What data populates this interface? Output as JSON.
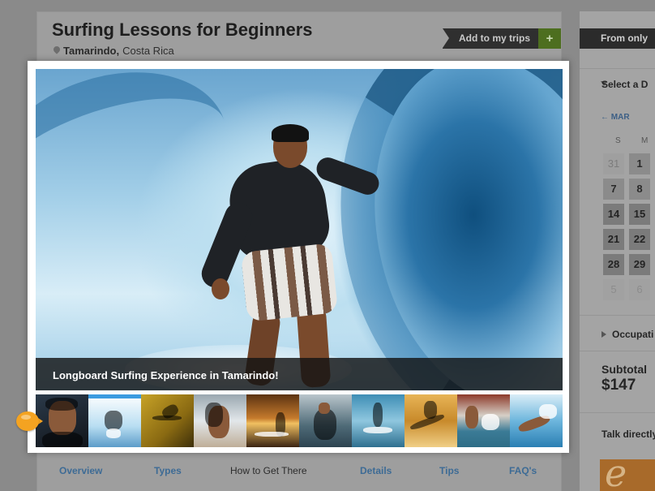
{
  "page": {
    "title": "Surfing Lessons for Beginners",
    "location_city": "Tamarindo,",
    "location_country": "Costa Rica",
    "add_to_trips_label": "Add to my trips",
    "add_to_trips_icon": "+"
  },
  "booking": {
    "price_label": "From only",
    "select_date_label": "Select a D",
    "month_label": "MAR",
    "month_back_icon": "←",
    "weekdays": [
      "S",
      "M"
    ],
    "calendar_rows": [
      [
        "31",
        "1"
      ],
      [
        "7",
        "8"
      ],
      [
        "14",
        "15"
      ],
      [
        "21",
        "22"
      ],
      [
        "28",
        "29"
      ],
      [
        "5",
        "6"
      ]
    ],
    "occupation_label": "Occupati",
    "subtotal_label": "Subtotal",
    "subtotal_value": "$147",
    "talk_label": "Talk directly",
    "promo_glyph": "e"
  },
  "tabs": [
    {
      "label": "Overview"
    },
    {
      "label": "Types"
    },
    {
      "label": "How to Get There"
    },
    {
      "label": "Details"
    },
    {
      "label": "Tips"
    },
    {
      "label": "FAQ's"
    }
  ],
  "lightbox": {
    "caption": "Longboard Surfing Experience in Tamarindo!",
    "selected_index": 1,
    "thumbnail_count": 10
  },
  "colors": {
    "tab_link": "#3d6b95",
    "thumb_selected": "#3b9be0",
    "pointer": "#f4a321",
    "add_button_green": "#4d6e1f"
  }
}
